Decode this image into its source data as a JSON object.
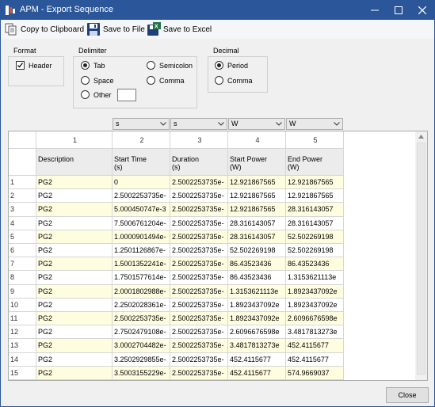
{
  "window": {
    "title": "APM - Export Sequence"
  },
  "toolbar": {
    "copy_label": "Copy to Clipboard",
    "save_file_label": "Save to File",
    "save_excel_label": "Save to Excel"
  },
  "format": {
    "label": "Format",
    "header_label": "Header",
    "header_checked": true
  },
  "delimiter": {
    "label": "Delimiter",
    "tab": "Tab",
    "space": "Space",
    "other": "Other",
    "semicolon": "Semicolon",
    "comma": "Comma",
    "selected": "Tab",
    "other_value": ""
  },
  "decimal": {
    "label": "Decimal",
    "period": "Period",
    "comma": "Comma",
    "selected": "Period"
  },
  "units": [
    "s",
    "s",
    "W",
    "W"
  ],
  "grid": {
    "column_numbers": [
      "1",
      "2",
      "3",
      "4",
      "5"
    ],
    "headers": [
      [
        "Description"
      ],
      [
        "Start Time",
        "(s)"
      ],
      [
        "Duration",
        "(s)"
      ],
      [
        "Start Power",
        "(W)"
      ],
      [
        "End Power",
        "(W)"
      ]
    ],
    "rows": [
      [
        "1",
        "PG2",
        "0",
        "2.5002253735e-",
        "12.921867565",
        "12.921867565"
      ],
      [
        "2",
        "PG2",
        "2.5002253735e-",
        "2.5002253735e-",
        "12.921867565",
        "12.921867565"
      ],
      [
        "3",
        "PG2",
        "5.000450747e-3",
        "2.5002253735e-",
        "12.921867565",
        "28.316143057"
      ],
      [
        "4",
        "PG2",
        "7.5006761204e-",
        "2.5002253735e-",
        "28.316143057",
        "28.316143057"
      ],
      [
        "5",
        "PG2",
        "1.0000901494e-",
        "2.5002253735e-",
        "28.316143057",
        "52.502269198"
      ],
      [
        "6",
        "PG2",
        "1.2501126867e-",
        "2.5002253735e-",
        "52.502269198",
        "52.502269198"
      ],
      [
        "7",
        "PG2",
        "1.5001352241e-",
        "2.5002253735e-",
        "86.43523436",
        "86.43523436"
      ],
      [
        "8",
        "PG2",
        "1.7501577614e-",
        "2.5002253735e-",
        "86.43523436",
        "1.3153621113e"
      ],
      [
        "9",
        "PG2",
        "2.0001802988e-",
        "2.5002253735e-",
        "1.3153621113e",
        "1.8923437092e"
      ],
      [
        "10",
        "PG2",
        "2.2502028361e-",
        "2.5002253735e-",
        "1.8923437092e",
        "1.8923437092e"
      ],
      [
        "11",
        "PG2",
        "2.5002253735e-",
        "2.5002253735e-",
        "1.8923437092e",
        "2.6096676598e"
      ],
      [
        "12",
        "PG2",
        "2.7502479108e-",
        "2.5002253735e-",
        "2.6096676598e",
        "3.4817813273e"
      ],
      [
        "13",
        "PG2",
        "3.0002704482e-",
        "2.5002253735e-",
        "3.4817813273e",
        "452.4115677"
      ],
      [
        "14",
        "PG2",
        "3.2502929855e-",
        "2.5002253735e-",
        "452.4115677",
        "452.4115677"
      ],
      [
        "15",
        "PG2",
        "3.5003155229e-",
        "2.5002253735e-",
        "452.4115677",
        "574.9669037"
      ]
    ]
  },
  "close_label": "Close",
  "colors": {
    "title_bar": "#2b579a",
    "highlight_row": "#fffde0",
    "excel_green": "#217346"
  }
}
